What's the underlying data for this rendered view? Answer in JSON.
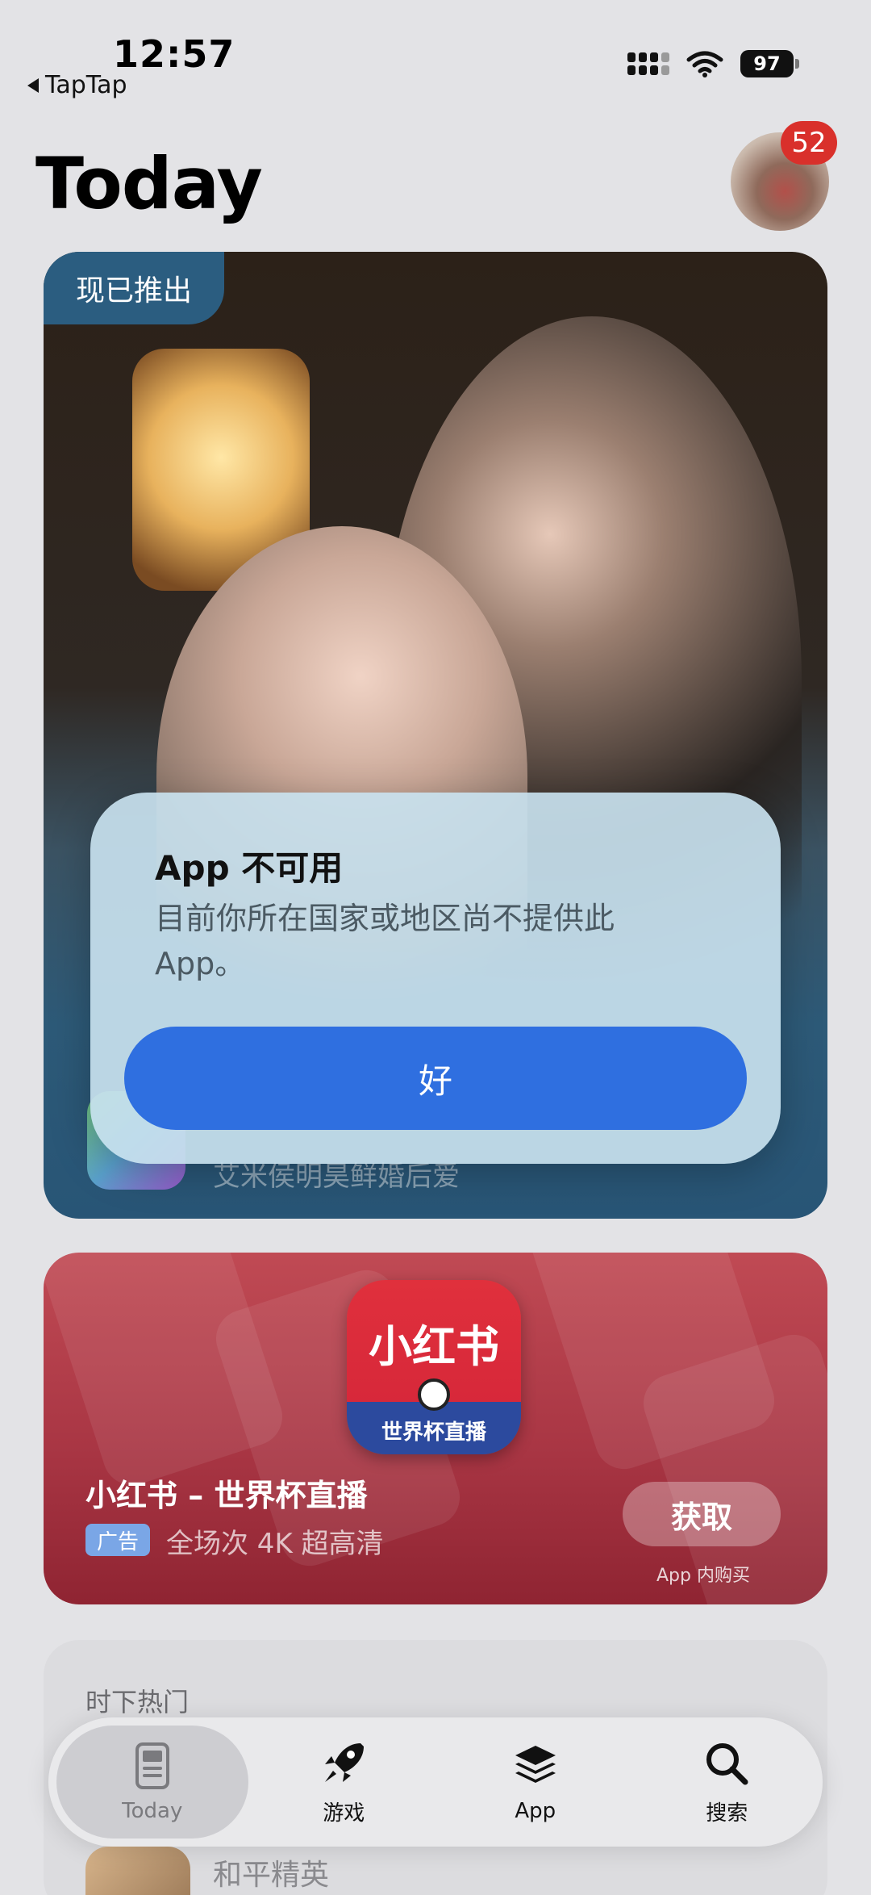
{
  "status_bar": {
    "time": "12:57",
    "back_label": "TapTap",
    "battery": "97",
    "icons": [
      "signal-icon",
      "wifi-icon",
      "battery-icon"
    ]
  },
  "header": {
    "title": "Today",
    "notification_count": "52"
  },
  "feature_card": {
    "tag": "现已推出",
    "subtitle": "艾米侯明昊鲜婚后爱"
  },
  "alert": {
    "title": "App 不可用",
    "message": "目前你所在国家或地区尚不提供此 App。",
    "button_label": "好"
  },
  "ad_card": {
    "icon_brand": "小红书",
    "icon_sub": "世界杯直播",
    "app_name": "小红书 – 世界杯直播",
    "badge": "广告",
    "description": "全场次 4K 超高清",
    "get_label": "获取",
    "iap_note": "App 内购买"
  },
  "trending_card": {
    "header": "时下热门",
    "item_name": "和平精英"
  },
  "tabbar": {
    "tabs": [
      {
        "label": "Today",
        "icon": "today-icon"
      },
      {
        "label": "游戏",
        "icon": "rocket-icon"
      },
      {
        "label": "App",
        "icon": "layers-icon"
      },
      {
        "label": "搜索",
        "icon": "search-icon"
      }
    ],
    "active_index": 0
  },
  "colors": {
    "accent": "#2f6fe0",
    "badge_red": "#d9302b",
    "ad_red": "#b03c48",
    "feature_blue": "#2b5d80"
  }
}
